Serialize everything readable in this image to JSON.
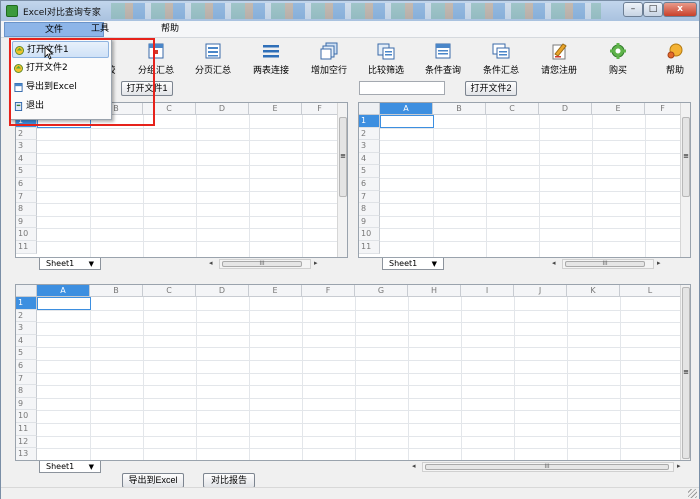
{
  "window": {
    "title": "Excel对比查询专家",
    "controls": {
      "minimize": "–",
      "maximize": "□",
      "close": "x"
    }
  },
  "menubar": {
    "file": "文件",
    "tools": "工具",
    "help": "帮助"
  },
  "file_menu": {
    "items": [
      {
        "label": "打开文件1",
        "icon": "open-file-icon"
      },
      {
        "label": "打开文件2",
        "icon": "open-file-icon"
      },
      {
        "label": "导出到Excel",
        "icon": "excel-export-icon"
      },
      {
        "label": "退出",
        "icon": "exit-icon"
      }
    ],
    "highlighted": 0
  },
  "toolbar": {
    "partial_label": "较",
    "buttons": [
      {
        "label": "分组汇总",
        "icon": "group-summary-icon"
      },
      {
        "label": "分页汇总",
        "icon": "page-summary-icon"
      },
      {
        "label": "两表连接",
        "icon": "join-tables-icon"
      },
      {
        "label": "增加空行",
        "icon": "add-rows-icon"
      },
      {
        "label": "比较筛选",
        "icon": "compare-filter-icon"
      },
      {
        "label": "条件查询",
        "icon": "condition-query-icon"
      },
      {
        "label": "条件汇总",
        "icon": "condition-summary-icon"
      },
      {
        "label": "请您注册",
        "icon": "register-icon"
      },
      {
        "label": "购买",
        "icon": "buy-icon"
      },
      {
        "label": "帮助",
        "icon": "help-icon"
      }
    ]
  },
  "file1": {
    "button": "打开文件1",
    "value": ""
  },
  "file2": {
    "button": "打开文件2",
    "value": ""
  },
  "grid_left": {
    "columns": [
      "A",
      "B",
      "C",
      "D",
      "E",
      "F"
    ],
    "rows": [
      "1",
      "2",
      "3",
      "4",
      "5",
      "6",
      "7",
      "8",
      "9",
      "10",
      "11"
    ],
    "sheet": "Sheet1",
    "scroll_label": "III",
    "vscroll_label": "≡"
  },
  "grid_right": {
    "columns": [
      "A",
      "B",
      "C",
      "D",
      "E",
      "F"
    ],
    "rows": [
      "1",
      "2",
      "3",
      "4",
      "5",
      "6",
      "7",
      "8",
      "9",
      "10",
      "11"
    ],
    "sheet": "Sheet1",
    "scroll_label": "III",
    "vscroll_label": "≡"
  },
  "grid_bottom": {
    "columns": [
      "A",
      "B",
      "C",
      "D",
      "E",
      "F",
      "G",
      "H",
      "I",
      "J",
      "K",
      "L"
    ],
    "rows": [
      "1",
      "2",
      "3",
      "4",
      "5",
      "6",
      "7",
      "8",
      "9",
      "10",
      "11",
      "12",
      "13"
    ],
    "sheet": "Sheet1",
    "scroll_label": "III",
    "vscroll_label": "≡"
  },
  "bottom_buttons": {
    "export": "导出到Excel",
    "report": "对比报告"
  },
  "colors": {
    "selection": "#3d8fe0",
    "highlight_box": "#e6221b",
    "menu_active": "#8db5e8"
  }
}
